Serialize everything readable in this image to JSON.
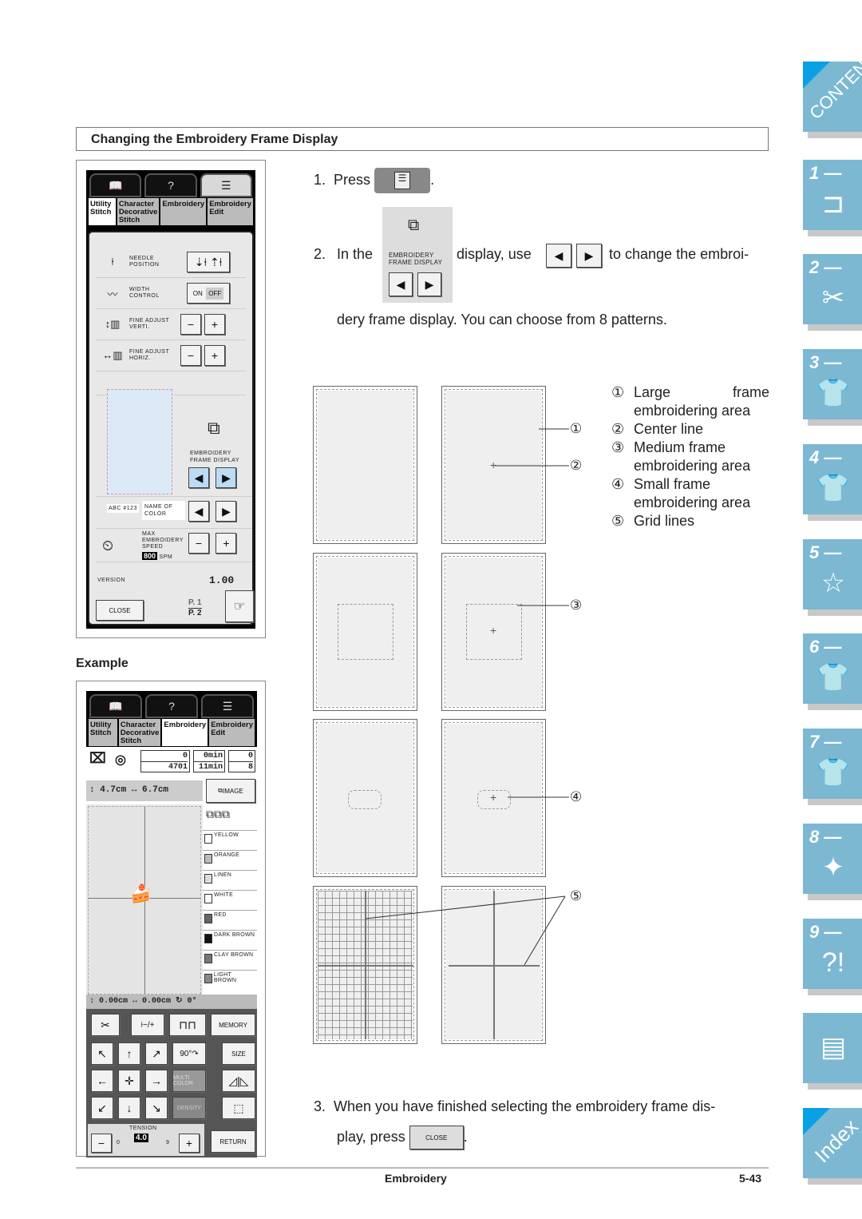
{
  "section_title": "Changing the Embroidery Frame Display",
  "example_label": "Example",
  "settings_screen": {
    "top_buttons": [
      "book-icon",
      "help-machine-icon",
      "settings-list-icon"
    ],
    "tabs": [
      "Utility Stitch",
      "Character Decorative Stitch",
      "Embroidery",
      "Embroidery Edit"
    ],
    "rows": [
      {
        "label": "NEEDLE POSITION",
        "controls": [
          "needle-down",
          "needle-up"
        ]
      },
      {
        "label": "WIDTH CONTROL",
        "controls": [
          "ON",
          "OFF"
        ]
      },
      {
        "label": "FINE ADJUST VERTI.",
        "controls": [
          "−",
          "+"
        ]
      },
      {
        "label": "FINE ADJUST HORIZ.",
        "controls": [
          "−",
          "+"
        ]
      }
    ],
    "frame_display_label": "EMBROIDERY FRAME DISPLAY",
    "name_of_color_label": "NAME OF COLOR",
    "color_badge": "ABC #123",
    "max_speed_label": "MAX EMBROIDERY SPEED",
    "max_speed_value": "800",
    "max_speed_unit": "SPM",
    "version_label": "VERSION",
    "version_value": "1.00",
    "close_label": "CLOSE",
    "page_current": "P. 1",
    "page_total": "P. 2"
  },
  "example_screen": {
    "tabs": [
      "Utility Stitch",
      "Character Decorative Stitch",
      "Embroidery",
      "Embroidery Edit"
    ],
    "stitch_count_top": "0",
    "stitch_count_bottom": "4701",
    "time_top": "0min",
    "time_bottom": "11min",
    "color_count_top": "0",
    "color_count_bottom": "8",
    "height": "4.7cm",
    "width": "6.7cm",
    "image_label": "IMAGE",
    "colors": [
      "YELLOW",
      "ORANGE",
      "LINEN",
      "WHITE",
      "RED",
      "DARK BROWN",
      "CLAY BROWN",
      "LIGHT BROWN"
    ],
    "color_swatches": [
      "#ffffff",
      "#bbbbbb",
      "#dddddd",
      "#ffffff",
      "#666666",
      "#111111",
      "#777777",
      "#888888"
    ],
    "offset_v": "0.00cm",
    "offset_h": "0.00cm",
    "angle": "0°",
    "memory_label": "MEMORY",
    "size_label": "SIZE",
    "rotate_label": "90°",
    "multi_color_label": "MULTI COLOR",
    "density_label": "DENSITY",
    "tension_label": "TENSION",
    "tension_min": "0",
    "tension_value": "4.0",
    "tension_max": "9",
    "return_label": "RETURN"
  },
  "steps": {
    "step1_num": "1.",
    "step1_text": "Press",
    "step1_end": ".",
    "step2_num": "2.",
    "step2_pre": "In the",
    "step2_panel_label": "EMBROIDERY FRAME DISPLAY",
    "step2_mid": "display, use",
    "step2_post": "to change the embroi-",
    "step2_line2": "dery frame display. You can choose from 8 patterns.",
    "step3_num": "3.",
    "step3_line1": "When you have finished selecting the embroidery frame dis-",
    "step3_line2": "play, press",
    "step3_button": "CLOSE",
    "step3_end": "."
  },
  "legend": [
    {
      "num": "①",
      "text": "Large frame embroidering area"
    },
    {
      "num": "②",
      "text": "Center line"
    },
    {
      "num": "③",
      "text": "Medium frame embroidering area"
    },
    {
      "num": "④",
      "text": "Small frame embroidering area"
    },
    {
      "num": "⑤",
      "text": "Grid lines"
    }
  ],
  "callouts": [
    "①",
    "②",
    "③",
    "④",
    "⑤"
  ],
  "side_tabs": [
    {
      "label": "CONTENTS"
    },
    {
      "num": "1 —",
      "icon": "sewing-machine-hand-icon"
    },
    {
      "num": "2 —",
      "icon": "thread-spool-scissors-icon"
    },
    {
      "num": "3 —",
      "icon": "shirt-stitch-icon"
    },
    {
      "num": "4 —",
      "icon": "shirt-abc-icon"
    },
    {
      "num": "5 —",
      "icon": "embroidery-hoop-star-icon"
    },
    {
      "num": "6 —",
      "icon": "shirt-arc-letters-icon"
    },
    {
      "num": "7 —",
      "icon": "shirt-needle-icon"
    },
    {
      "num": "8 —",
      "icon": "machine-care-icon"
    },
    {
      "num": "9 —",
      "icon": "machine-troubleshoot-icon"
    },
    {
      "icon": "pages-icon"
    },
    {
      "label": "Index"
    }
  ],
  "footer": {
    "chapter": "Embroidery",
    "page": "5-43"
  }
}
